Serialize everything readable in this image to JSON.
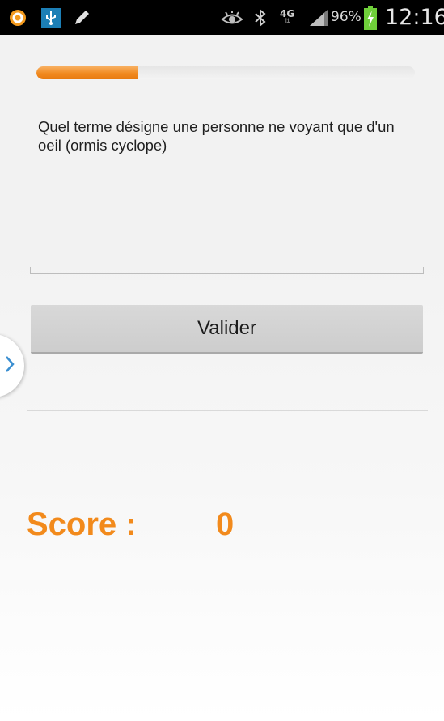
{
  "status_bar": {
    "icons": [
      "orange-app-icon",
      "usb-icon",
      "pencil-icon",
      "eye-icon",
      "bluetooth-icon",
      "network-4g-icon",
      "signal-icon",
      "battery-charging-icon"
    ],
    "network": "4G",
    "battery": "96%",
    "time": "12:16"
  },
  "quiz": {
    "progress_fraction": 0.27,
    "question": "Quel terme désigne une personne ne voyant que d'un oeil (ormis cyclope)",
    "answer_value": "",
    "answer_placeholder": "",
    "validate_label": "Valider"
  },
  "score": {
    "label": "Score :",
    "value": "0"
  },
  "colors": {
    "accent": "#f28a1c",
    "statusbar": "#000000",
    "button": "#d1d1d1"
  }
}
